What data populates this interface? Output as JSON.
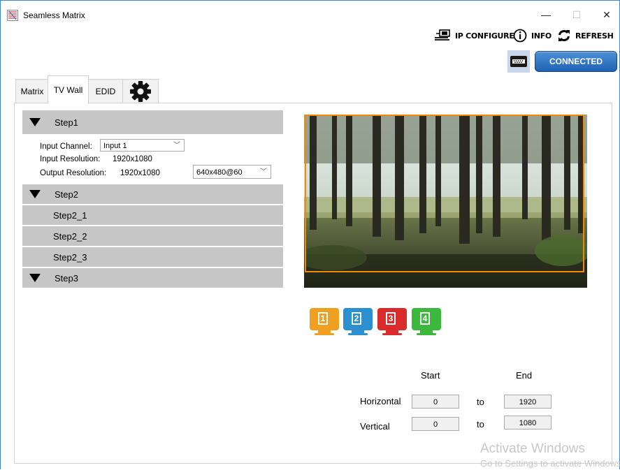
{
  "window": {
    "title": "Seamless Matrix",
    "minimize": "—",
    "maximize": "☐",
    "close": "✕"
  },
  "toolbar": {
    "ip_configure": "IP CONFIGURE",
    "info": "INFO",
    "refresh": "REFRESH",
    "connected": "CONNECTED"
  },
  "tabs": [
    "Matrix",
    "TV Wall",
    "EDID"
  ],
  "active_tab": "TV Wall",
  "steps": {
    "step1": "Step1",
    "step2": "Step2",
    "step2_1": "Step2_1",
    "step2_2": "Step2_2",
    "step2_3": "Step2_3",
    "step3": "Step3"
  },
  "form": {
    "input_channel_label": "Input Channel:",
    "input_channel_value": "Input 1",
    "input_resolution_label": "Input Resolution:",
    "input_resolution_value": "1920x1080",
    "output_resolution_label": "Output Resolution:",
    "output_resolution_value": "1920x1080",
    "output_mode_value": "640x480@60"
  },
  "monitors": [
    {
      "num": "1",
      "color": "#f0a020"
    },
    {
      "num": "2",
      "color": "#2b8fd0"
    },
    {
      "num": "3",
      "color": "#d92b2b"
    },
    {
      "num": "4",
      "color": "#3cb83c"
    }
  ],
  "coords": {
    "start_label": "Start",
    "end_label": "End",
    "horizontal_label": "Horizontal",
    "vertical_label": "Vertical",
    "to": "to",
    "h_start": "0",
    "h_end": "1920",
    "v_start": "0",
    "v_end": "1080"
  },
  "watermark": {
    "line1": "Activate Windows",
    "line2": "Go to Settings to activate Windows."
  },
  "colors": {
    "accent_border": "#f08a00",
    "connected_button": "#2a6fc0",
    "step_bg": "#c6c6c6"
  }
}
